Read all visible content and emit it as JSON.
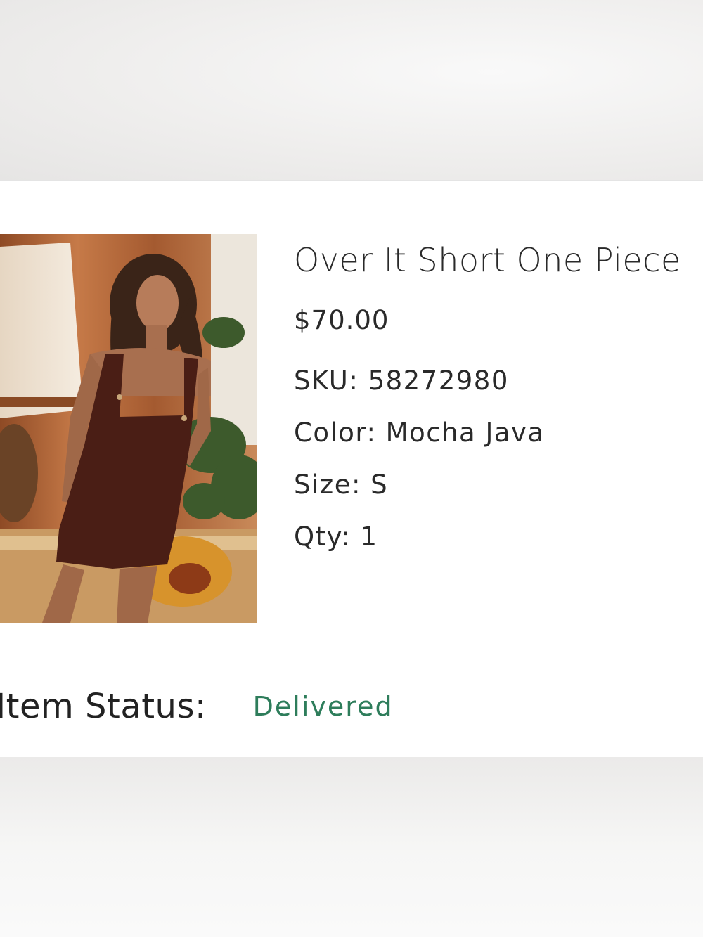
{
  "product": {
    "name": "Over It Short One Piece",
    "price": "$70.00",
    "sku": "SKU: 58272980",
    "color": "Color: Mocha Java",
    "size": "Size: S",
    "qty": "Qty: 1",
    "image_alt": "Model wearing brown short overalls"
  },
  "status": {
    "label": "Item Status:",
    "value": "Delivered",
    "value_color": "#2e7d5b"
  }
}
